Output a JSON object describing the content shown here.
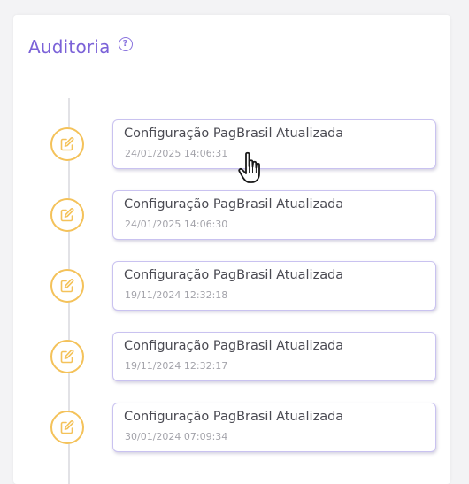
{
  "header": {
    "title": "Auditoria",
    "help_icon": "question-circle-icon"
  },
  "colors": {
    "title": "#7b62d8",
    "icon_ring": "#f4c25a",
    "card_border": "#c9c2f0"
  },
  "events": [
    {
      "title": "Configuração PagBrasil Atualizada",
      "date": "24/01/2025 14:06:31",
      "icon": "edit-icon"
    },
    {
      "title": "Configuração PagBrasil Atualizada",
      "date": "24/01/2025 14:06:30",
      "icon": "edit-icon"
    },
    {
      "title": "Configuração PagBrasil Atualizada",
      "date": "19/11/2024 12:32:18",
      "icon": "edit-icon"
    },
    {
      "title": "Configuração PagBrasil Atualizada",
      "date": "19/11/2024 12:32:17",
      "icon": "edit-icon"
    },
    {
      "title": "Configuração PagBrasil Atualizada",
      "date": "30/01/2024 07:09:34",
      "icon": "edit-icon"
    }
  ]
}
